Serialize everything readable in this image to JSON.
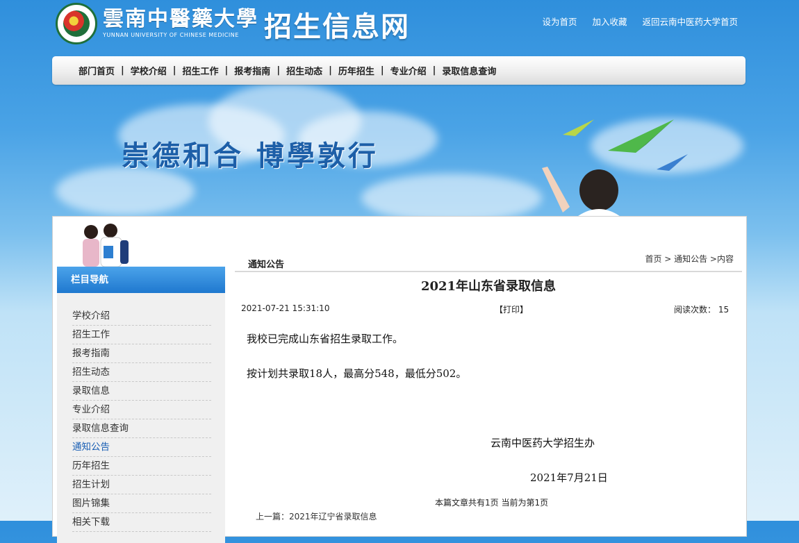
{
  "header": {
    "logo_cn": "雲南中醫藥大學",
    "logo_en": "YUNNAN UNIVERSITY OF CHINESE MEDICINE",
    "site_title": "招生信息网",
    "links": [
      "设为首页",
      "加入收藏",
      "返回云南中医药大学首页"
    ]
  },
  "nav": {
    "items": [
      "部门首页",
      "学校介绍",
      "招生工作",
      "报考指南",
      "招生动态",
      "历年招生",
      "专业介绍",
      "录取信息查询"
    ],
    "separator": "|"
  },
  "banner": {
    "slogan": "崇德和合  博學敦行"
  },
  "sidebar": {
    "heading": "栏目导航",
    "items": [
      "学校介绍",
      "招生工作",
      "报考指南",
      "招生动态",
      "录取信息",
      "专业介绍",
      "录取信息查询",
      "通知公告",
      "历年招生",
      "招生计划",
      "图片锦集",
      "相关下载"
    ],
    "active_index": 7
  },
  "content": {
    "section": "通知公告",
    "breadcrumb": "首页 > 通知公告 >内容",
    "title": "2021年山东省录取信息",
    "date": "2021-07-21 15:31:10",
    "print": "【打印】",
    "reads_label": "阅读次数：",
    "reads": "15",
    "paragraphs": [
      "我校已完成山东省招生录取工作。",
      "按计划共录取18人，最高分548，最低分502。"
    ],
    "signature_org": "云南中医药大学招生办",
    "signature_date": "2021年7月21日",
    "page_info": "本篇文章共有1页 当前为第1页",
    "prev": "上一篇：2021年辽宁省录取信息"
  },
  "colors": {
    "sky_top": "#2f8fdc",
    "nav_bg": "#eeeeee",
    "side_head": "#1f78cf",
    "active_link": "#1a5fb4"
  }
}
